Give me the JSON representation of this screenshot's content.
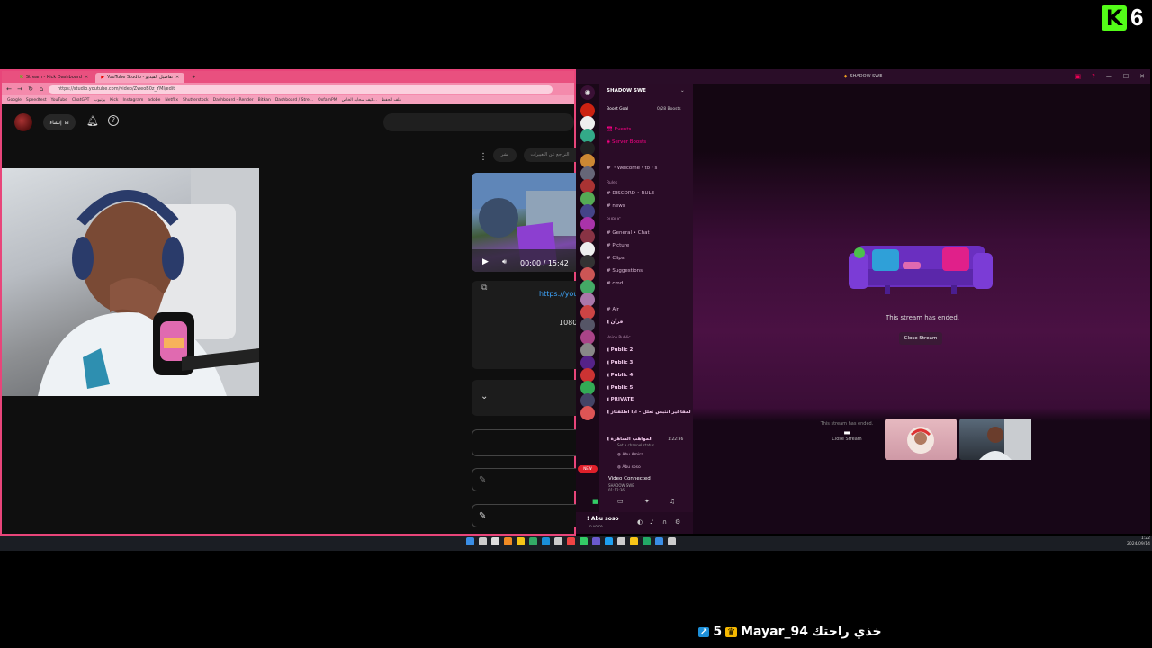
{
  "overlay": {
    "logo_letter": "K",
    "viewer_count": "6"
  },
  "browser": {
    "tabs": [
      {
        "label": "Stream - Kick Dashboard",
        "active": false
      },
      {
        "label": "YouTube Studio - تفاصيل الفيديو",
        "active": true
      }
    ],
    "new_tab": "+",
    "url": "https://studio.youtube.com/video/ZweoB0z_YMI/edit",
    "bookmarks": [
      "Google",
      "Speedtest",
      "YouTube",
      "ChatGPT",
      "يوتيوب",
      "Kick",
      "Instagram",
      "adobe",
      "Netflix",
      "Shutterstock",
      "Dashboard - Render",
      "Bitkan",
      "Dashboard / Stre...",
      "OxfamPM",
      "كيف سحابة الخاص...",
      "ملف الحفظ"
    ],
    "yt": {
      "create_label": "إنشاء",
      "chip_short": "نشر",
      "chip_long": "التراجع عن التغييرات",
      "video_time": "00:00 / 15:42",
      "link": "https://you",
      "resolution": "1080"
    }
  },
  "discord": {
    "window_title": "SHADOW SWE",
    "server_name": "SHADOW SWE",
    "boost_goal": "Boost Goal",
    "boost_count": "0/28 Boosts",
    "top_links": [
      "Events",
      "Server Boosts"
    ],
    "channels": [
      {
        "kind": "text",
        "label": "・Welcome・to・s"
      },
      {
        "kind": "cat",
        "label": "Rules"
      },
      {
        "kind": "text",
        "label": "DISCORD • RULE"
      },
      {
        "kind": "text",
        "label": "news"
      },
      {
        "kind": "cat",
        "label": "PUBLIC"
      },
      {
        "kind": "text",
        "label": "General • Chat"
      },
      {
        "kind": "text",
        "label": "Picture"
      },
      {
        "kind": "text",
        "label": "Clips"
      },
      {
        "kind": "text",
        "label": "Suggestions"
      },
      {
        "kind": "text",
        "label": "cmd"
      },
      {
        "kind": "text",
        "label": "Ajr"
      },
      {
        "kind": "voice",
        "label": "قرآن"
      },
      {
        "kind": "cat",
        "label": "Voice Public"
      },
      {
        "kind": "voice",
        "label": "Public 2"
      },
      {
        "kind": "voice",
        "label": "Public 3"
      },
      {
        "kind": "voice",
        "label": "Public 4"
      },
      {
        "kind": "voice",
        "label": "Public 5"
      },
      {
        "kind": "voice",
        "label": "PRIVATE"
      },
      {
        "kind": "voice",
        "label": "لمقاعير انتبس نعلل - اذا اطلقتاز"
      },
      {
        "kind": "voice",
        "label": "المواهب الساهرة"
      }
    ],
    "voice_duration": "1:22:36",
    "voice_status": "Set a channel status",
    "voice_members": [
      "Abu Amira",
      "Abu soso"
    ],
    "new_badge": "NEW",
    "connection": {
      "status": "Video Connected",
      "channel": "SHADOW SWE",
      "time": "01:12:36"
    },
    "user": {
      "name": "! Abu soso",
      "status": "In voice"
    },
    "stream": {
      "ended_text": "This stream has ended.",
      "close_button": "Close Stream",
      "mini_ended": "This stream has ended.",
      "mini_close": "Close Stream"
    }
  },
  "taskbar": {
    "clock": "1:22",
    "date": "2024/09/14"
  },
  "chat": {
    "username": "Mayar_94",
    "message": "خذي راحتك",
    "count": "5"
  }
}
